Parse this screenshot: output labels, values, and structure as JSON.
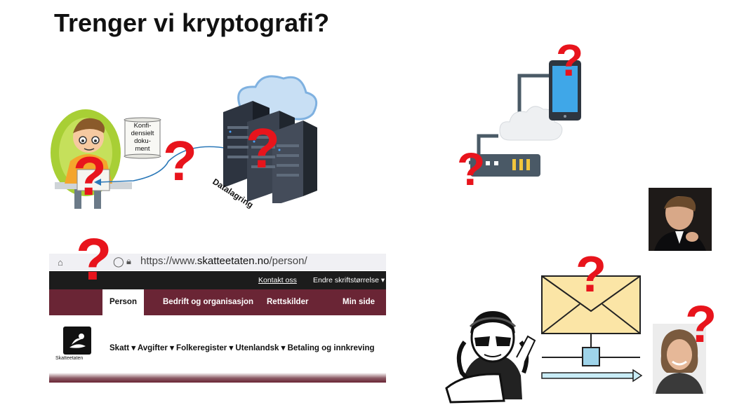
{
  "slide": {
    "title": "Trenger vi kryptografi?"
  },
  "illustration": {
    "document_label": "Konfi-\ndensielt\ndoku-\nment",
    "storage_label": "Datalagring",
    "question_mark": "?"
  },
  "browser": {
    "url_prefix": "https://www.",
    "url_domain": "skatteetaten.no",
    "url_path": "/person/",
    "top_links": [
      "Kontakt oss",
      "Endre skriftstørrelse ▾"
    ],
    "nav_tabs": [
      "Person",
      "Bedrift og organisasjon",
      "Rettskilder",
      "Min side"
    ],
    "logo_text": "Skatteetaten",
    "menu_items": "Skatt ▾  Avgifter ▾  Folkeregister ▾  Utenlandsk ▾  Betaling og innkreving"
  },
  "colors": {
    "question": "#e8141c",
    "skatteetaten_brand": "#6a2535",
    "topbar": "#1c1c1c"
  }
}
